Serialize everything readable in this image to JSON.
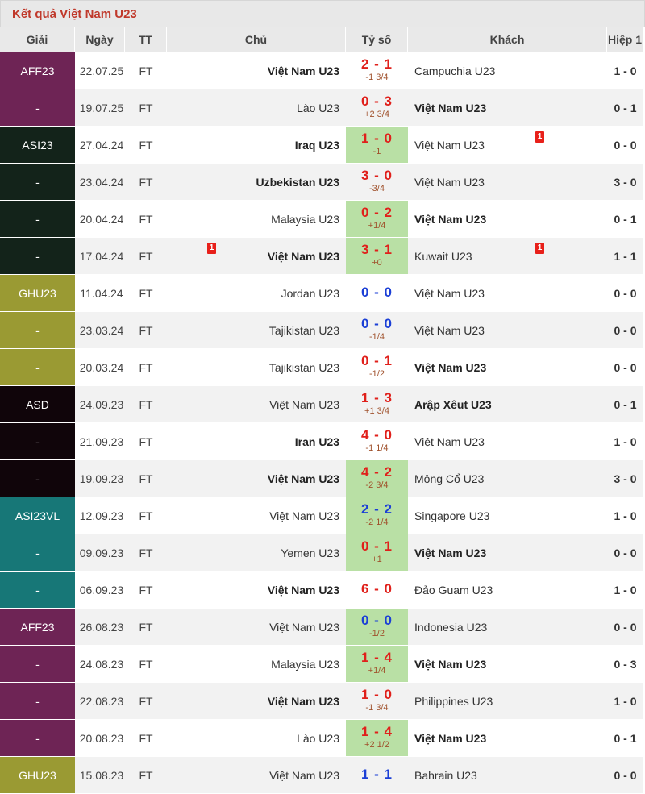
{
  "page": {
    "title": "Kết quả Việt Nam U23"
  },
  "columns": [
    "Giải",
    "Ngày",
    "TT",
    "Chủ",
    "Tỷ số",
    "Khách",
    "Hiệp 1"
  ],
  "colors": {
    "AFF23": "#6e2455",
    "ASI23": "#13231a",
    "GHU23": "#9a9a33",
    "ASD": "#10050a",
    "ASI23VL": "#177777",
    "score_win": "#e0201b",
    "score_draw": "#1b3fd6",
    "score_green_bg": "#b9e0a5"
  },
  "rows": [
    {
      "league": "AFF23",
      "leagueKey": "AFF23",
      "date": "22.07.25",
      "status": "FT",
      "home": "Việt Nam U23",
      "homeBold": true,
      "score": "2 - 1",
      "scoreType": "win",
      "green": false,
      "handicap": "-1 3/4",
      "away": "Campuchia U23",
      "awayBold": false,
      "ht": "1 - 0",
      "homeCard": "",
      "awayCard": ""
    },
    {
      "league": "-",
      "leagueKey": "AFF23",
      "date": "19.07.25",
      "status": "FT",
      "home": "Lào U23",
      "homeBold": false,
      "score": "0 - 3",
      "scoreType": "win",
      "green": false,
      "handicap": "+2 3/4",
      "away": "Việt Nam U23",
      "awayBold": true,
      "ht": "0 - 1",
      "homeCard": "",
      "awayCard": ""
    },
    {
      "league": "ASI23",
      "leagueKey": "ASI23",
      "date": "27.04.24",
      "status": "FT",
      "home": "Iraq U23",
      "homeBold": true,
      "score": "1 - 0",
      "scoreType": "win",
      "green": true,
      "handicap": "-1",
      "away": "Việt Nam U23",
      "awayBold": false,
      "ht": "0 - 0",
      "homeCard": "",
      "awayCard": "1"
    },
    {
      "league": "-",
      "leagueKey": "ASI23",
      "date": "23.04.24",
      "status": "FT",
      "home": "Uzbekistan U23",
      "homeBold": true,
      "score": "3 - 0",
      "scoreType": "win",
      "green": false,
      "handicap": "-3/4",
      "away": "Việt Nam U23",
      "awayBold": false,
      "ht": "3 - 0",
      "homeCard": "",
      "awayCard": ""
    },
    {
      "league": "-",
      "leagueKey": "ASI23",
      "date": "20.04.24",
      "status": "FT",
      "home": "Malaysia U23",
      "homeBold": false,
      "score": "0 - 2",
      "scoreType": "win",
      "green": true,
      "handicap": "+1/4",
      "away": "Việt Nam U23",
      "awayBold": true,
      "ht": "0 - 1",
      "homeCard": "",
      "awayCard": ""
    },
    {
      "league": "-",
      "leagueKey": "ASI23",
      "date": "17.04.24",
      "status": "FT",
      "home": "Việt Nam U23",
      "homeBold": true,
      "score": "3 - 1",
      "scoreType": "win",
      "green": true,
      "handicap": "+0",
      "away": "Kuwait U23",
      "awayBold": false,
      "ht": "1 - 1",
      "homeCard": "1",
      "awayCard": "1"
    },
    {
      "league": "GHU23",
      "leagueKey": "GHU23",
      "date": "11.04.24",
      "status": "FT",
      "home": "Jordan U23",
      "homeBold": false,
      "score": "0 - 0",
      "scoreType": "draw",
      "green": false,
      "handicap": "",
      "away": "Việt Nam U23",
      "awayBold": false,
      "ht": "0 - 0",
      "homeCard": "",
      "awayCard": ""
    },
    {
      "league": "-",
      "leagueKey": "GHU23",
      "date": "23.03.24",
      "status": "FT",
      "home": "Tajikistan U23",
      "homeBold": false,
      "score": "0 - 0",
      "scoreType": "draw",
      "green": false,
      "handicap": "-1/4",
      "away": "Việt Nam U23",
      "awayBold": false,
      "ht": "0 - 0",
      "homeCard": "",
      "awayCard": ""
    },
    {
      "league": "-",
      "leagueKey": "GHU23",
      "date": "20.03.24",
      "status": "FT",
      "home": "Tajikistan U23",
      "homeBold": false,
      "score": "0 - 1",
      "scoreType": "win",
      "green": false,
      "handicap": "-1/2",
      "away": "Việt Nam U23",
      "awayBold": true,
      "ht": "0 - 0",
      "homeCard": "",
      "awayCard": ""
    },
    {
      "league": "ASD",
      "leagueKey": "ASD",
      "date": "24.09.23",
      "status": "FT",
      "home": "Việt Nam U23",
      "homeBold": false,
      "score": "1 - 3",
      "scoreType": "win",
      "green": false,
      "handicap": "+1 3/4",
      "away": "Arập Xêut U23",
      "awayBold": true,
      "ht": "0 - 1",
      "homeCard": "",
      "awayCard": ""
    },
    {
      "league": "-",
      "leagueKey": "ASD",
      "date": "21.09.23",
      "status": "FT",
      "home": "Iran U23",
      "homeBold": true,
      "score": "4 - 0",
      "scoreType": "win",
      "green": false,
      "handicap": "-1 1/4",
      "away": "Việt Nam U23",
      "awayBold": false,
      "ht": "1 - 0",
      "homeCard": "",
      "awayCard": ""
    },
    {
      "league": "-",
      "leagueKey": "ASD",
      "date": "19.09.23",
      "status": "FT",
      "home": "Việt Nam U23",
      "homeBold": true,
      "score": "4 - 2",
      "scoreType": "win",
      "green": true,
      "handicap": "-2 3/4",
      "away": "Mông Cổ U23",
      "awayBold": false,
      "ht": "3 - 0",
      "homeCard": "",
      "awayCard": ""
    },
    {
      "league": "ASI23VL",
      "leagueKey": "ASI23VL",
      "date": "12.09.23",
      "status": "FT",
      "home": "Việt Nam U23",
      "homeBold": false,
      "score": "2 - 2",
      "scoreType": "draw",
      "green": true,
      "handicap": "-2 1/4",
      "away": "Singapore U23",
      "awayBold": false,
      "ht": "1 - 0",
      "homeCard": "",
      "awayCard": ""
    },
    {
      "league": "-",
      "leagueKey": "ASI23VL",
      "date": "09.09.23",
      "status": "FT",
      "home": "Yemen U23",
      "homeBold": false,
      "score": "0 - 1",
      "scoreType": "win",
      "green": true,
      "handicap": "+1",
      "away": "Việt Nam U23",
      "awayBold": true,
      "ht": "0 - 0",
      "homeCard": "",
      "awayCard": ""
    },
    {
      "league": "-",
      "leagueKey": "ASI23VL",
      "date": "06.09.23",
      "status": "FT",
      "home": "Việt Nam U23",
      "homeBold": true,
      "score": "6 - 0",
      "scoreType": "win",
      "green": false,
      "handicap": "",
      "away": "Đảo Guam U23",
      "awayBold": false,
      "ht": "1 - 0",
      "homeCard": "",
      "awayCard": ""
    },
    {
      "league": "AFF23",
      "leagueKey": "AFF23",
      "date": "26.08.23",
      "status": "FT",
      "home": "Việt Nam U23",
      "homeBold": false,
      "score": "0 - 0",
      "scoreType": "draw",
      "green": true,
      "handicap": "-1/2",
      "away": "Indonesia U23",
      "awayBold": false,
      "ht": "0 - 0",
      "homeCard": "",
      "awayCard": ""
    },
    {
      "league": "-",
      "leagueKey": "AFF23",
      "date": "24.08.23",
      "status": "FT",
      "home": "Malaysia U23",
      "homeBold": false,
      "score": "1 - 4",
      "scoreType": "win",
      "green": true,
      "handicap": "+1/4",
      "away": "Việt Nam U23",
      "awayBold": true,
      "ht": "0 - 3",
      "homeCard": "",
      "awayCard": ""
    },
    {
      "league": "-",
      "leagueKey": "AFF23",
      "date": "22.08.23",
      "status": "FT",
      "home": "Việt Nam U23",
      "homeBold": true,
      "score": "1 - 0",
      "scoreType": "win",
      "green": false,
      "handicap": "-1 3/4",
      "away": "Philippines U23",
      "awayBold": false,
      "ht": "1 - 0",
      "homeCard": "",
      "awayCard": ""
    },
    {
      "league": "-",
      "leagueKey": "AFF23",
      "date": "20.08.23",
      "status": "FT",
      "home": "Lào U23",
      "homeBold": false,
      "score": "1 - 4",
      "scoreType": "win",
      "green": true,
      "handicap": "+2 1/2",
      "away": "Việt Nam U23",
      "awayBold": true,
      "ht": "0 - 1",
      "homeCard": "",
      "awayCard": ""
    },
    {
      "league": "GHU23",
      "leagueKey": "GHU23",
      "date": "15.08.23",
      "status": "FT",
      "home": "Việt Nam U23",
      "homeBold": false,
      "score": "1 - 1",
      "scoreType": "draw",
      "green": false,
      "handicap": "",
      "away": "Bahrain U23",
      "awayBold": false,
      "ht": "0 - 0",
      "homeCard": "",
      "awayCard": ""
    }
  ]
}
